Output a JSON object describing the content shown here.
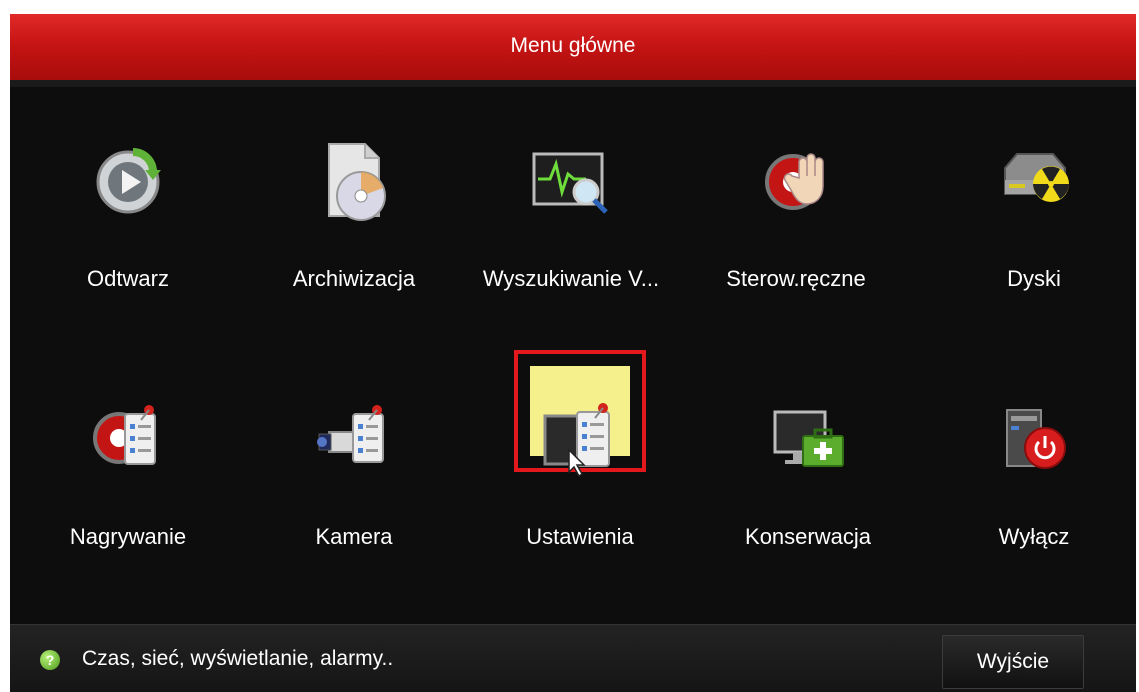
{
  "window": {
    "title": "Menu główne"
  },
  "menu": {
    "items": [
      {
        "label": "Odtwarz",
        "icon": "playback-icon"
      },
      {
        "label": "Archiwizacja",
        "icon": "export-disc-icon"
      },
      {
        "label": "Wyszukiwanie V...",
        "icon": "vca-search-icon"
      },
      {
        "label": "Sterow.ręczne",
        "icon": "manual-control-icon"
      },
      {
        "label": "Dyski",
        "icon": "hdd-icon"
      },
      {
        "label": "Nagrywanie",
        "icon": "record-settings-icon"
      },
      {
        "label": "Kamera",
        "icon": "camera-settings-icon"
      },
      {
        "label": "Ustawienia",
        "icon": "configuration-icon",
        "selected": true
      },
      {
        "label": "Konserwacja",
        "icon": "maintenance-icon"
      },
      {
        "label": "Wyłącz",
        "icon": "shutdown-icon"
      }
    ]
  },
  "status": {
    "help_icon": "help-icon",
    "text": "Czas, sieć, wyświetlanie, alarmy.."
  },
  "footer": {
    "exit_label": "Wyjście"
  },
  "colors": {
    "title_red": "#c71414",
    "selection_red": "#e3181d",
    "selection_bg": "#f5f08b"
  }
}
